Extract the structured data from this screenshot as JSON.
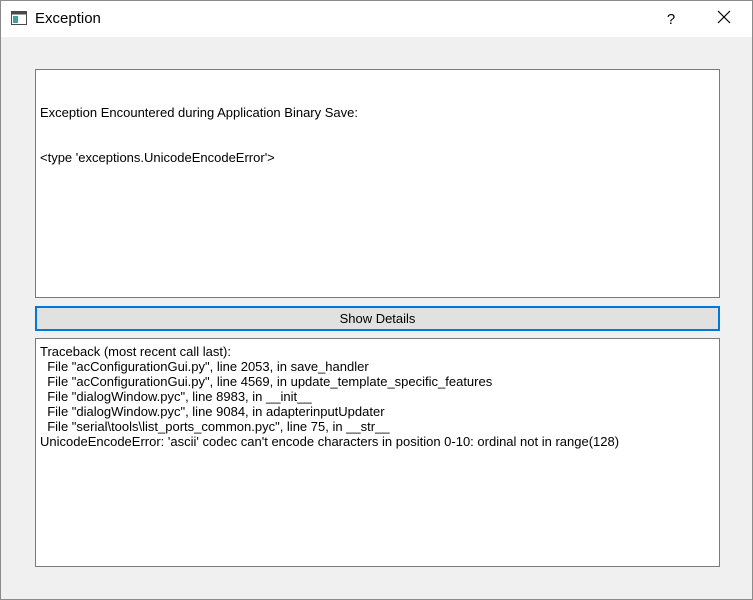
{
  "window": {
    "title": "Exception",
    "help_label": "?",
    "icons": {
      "app": "window-app-icon",
      "close": "close-icon"
    }
  },
  "message": {
    "line1": "Exception Encountered during Application Binary Save:",
    "line2": "<type 'exceptions.UnicodeEncodeError'>"
  },
  "details_button": {
    "label": "Show Details"
  },
  "traceback": {
    "lines": [
      "Traceback (most recent call last):",
      "  File \"acConfigurationGui.py\", line 2053, in save_handler",
      "  File \"acConfigurationGui.py\", line 4569, in update_template_specific_features",
      "  File \"dialogWindow.pyc\", line 8983, in __init__",
      "  File \"dialogWindow.pyc\", line 9084, in adapterinputUpdater",
      "  File \"serial\\tools\\list_ports_common.pyc\", line 75, in __str__",
      "UnicodeEncodeError: 'ascii' codec can't encode characters in position 0-10: ordinal not in range(128)"
    ]
  },
  "colors": {
    "accent": "#0078d7",
    "background": "#f0f0f0",
    "border": "#7a7a7a"
  }
}
